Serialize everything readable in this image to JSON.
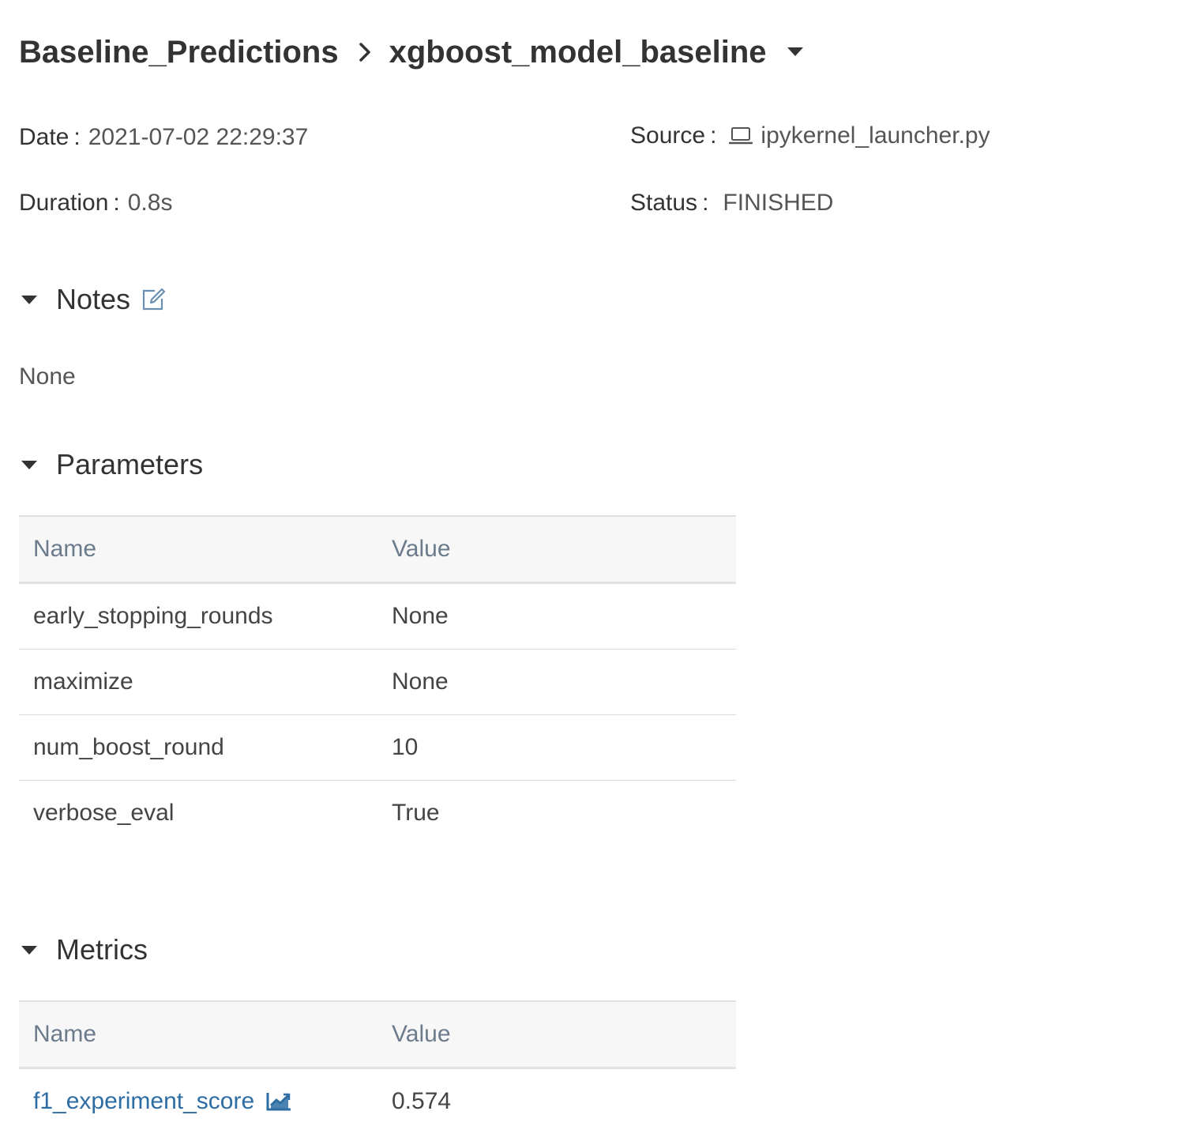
{
  "breadcrumb": {
    "experiment": "Baseline_Predictions",
    "run": "xgboost_model_baseline"
  },
  "meta": {
    "date_label": "Date",
    "date_value": "2021-07-02 22:29:37",
    "source_label": "Source",
    "source_value": "ipykernel_launcher.py",
    "duration_label": "Duration",
    "duration_value": "0.8s",
    "status_label": "Status",
    "status_value": "FINISHED"
  },
  "notes": {
    "title": "Notes",
    "content": "None"
  },
  "parameters": {
    "title": "Parameters",
    "header_name": "Name",
    "header_value": "Value",
    "rows": [
      {
        "name": "early_stopping_rounds",
        "value": "None"
      },
      {
        "name": "maximize",
        "value": "None"
      },
      {
        "name": "num_boost_round",
        "value": "10"
      },
      {
        "name": "verbose_eval",
        "value": "True"
      }
    ]
  },
  "metrics": {
    "title": "Metrics",
    "header_name": "Name",
    "header_value": "Value",
    "rows": [
      {
        "name": "f1_experiment_score",
        "value": "0.574"
      }
    ]
  }
}
